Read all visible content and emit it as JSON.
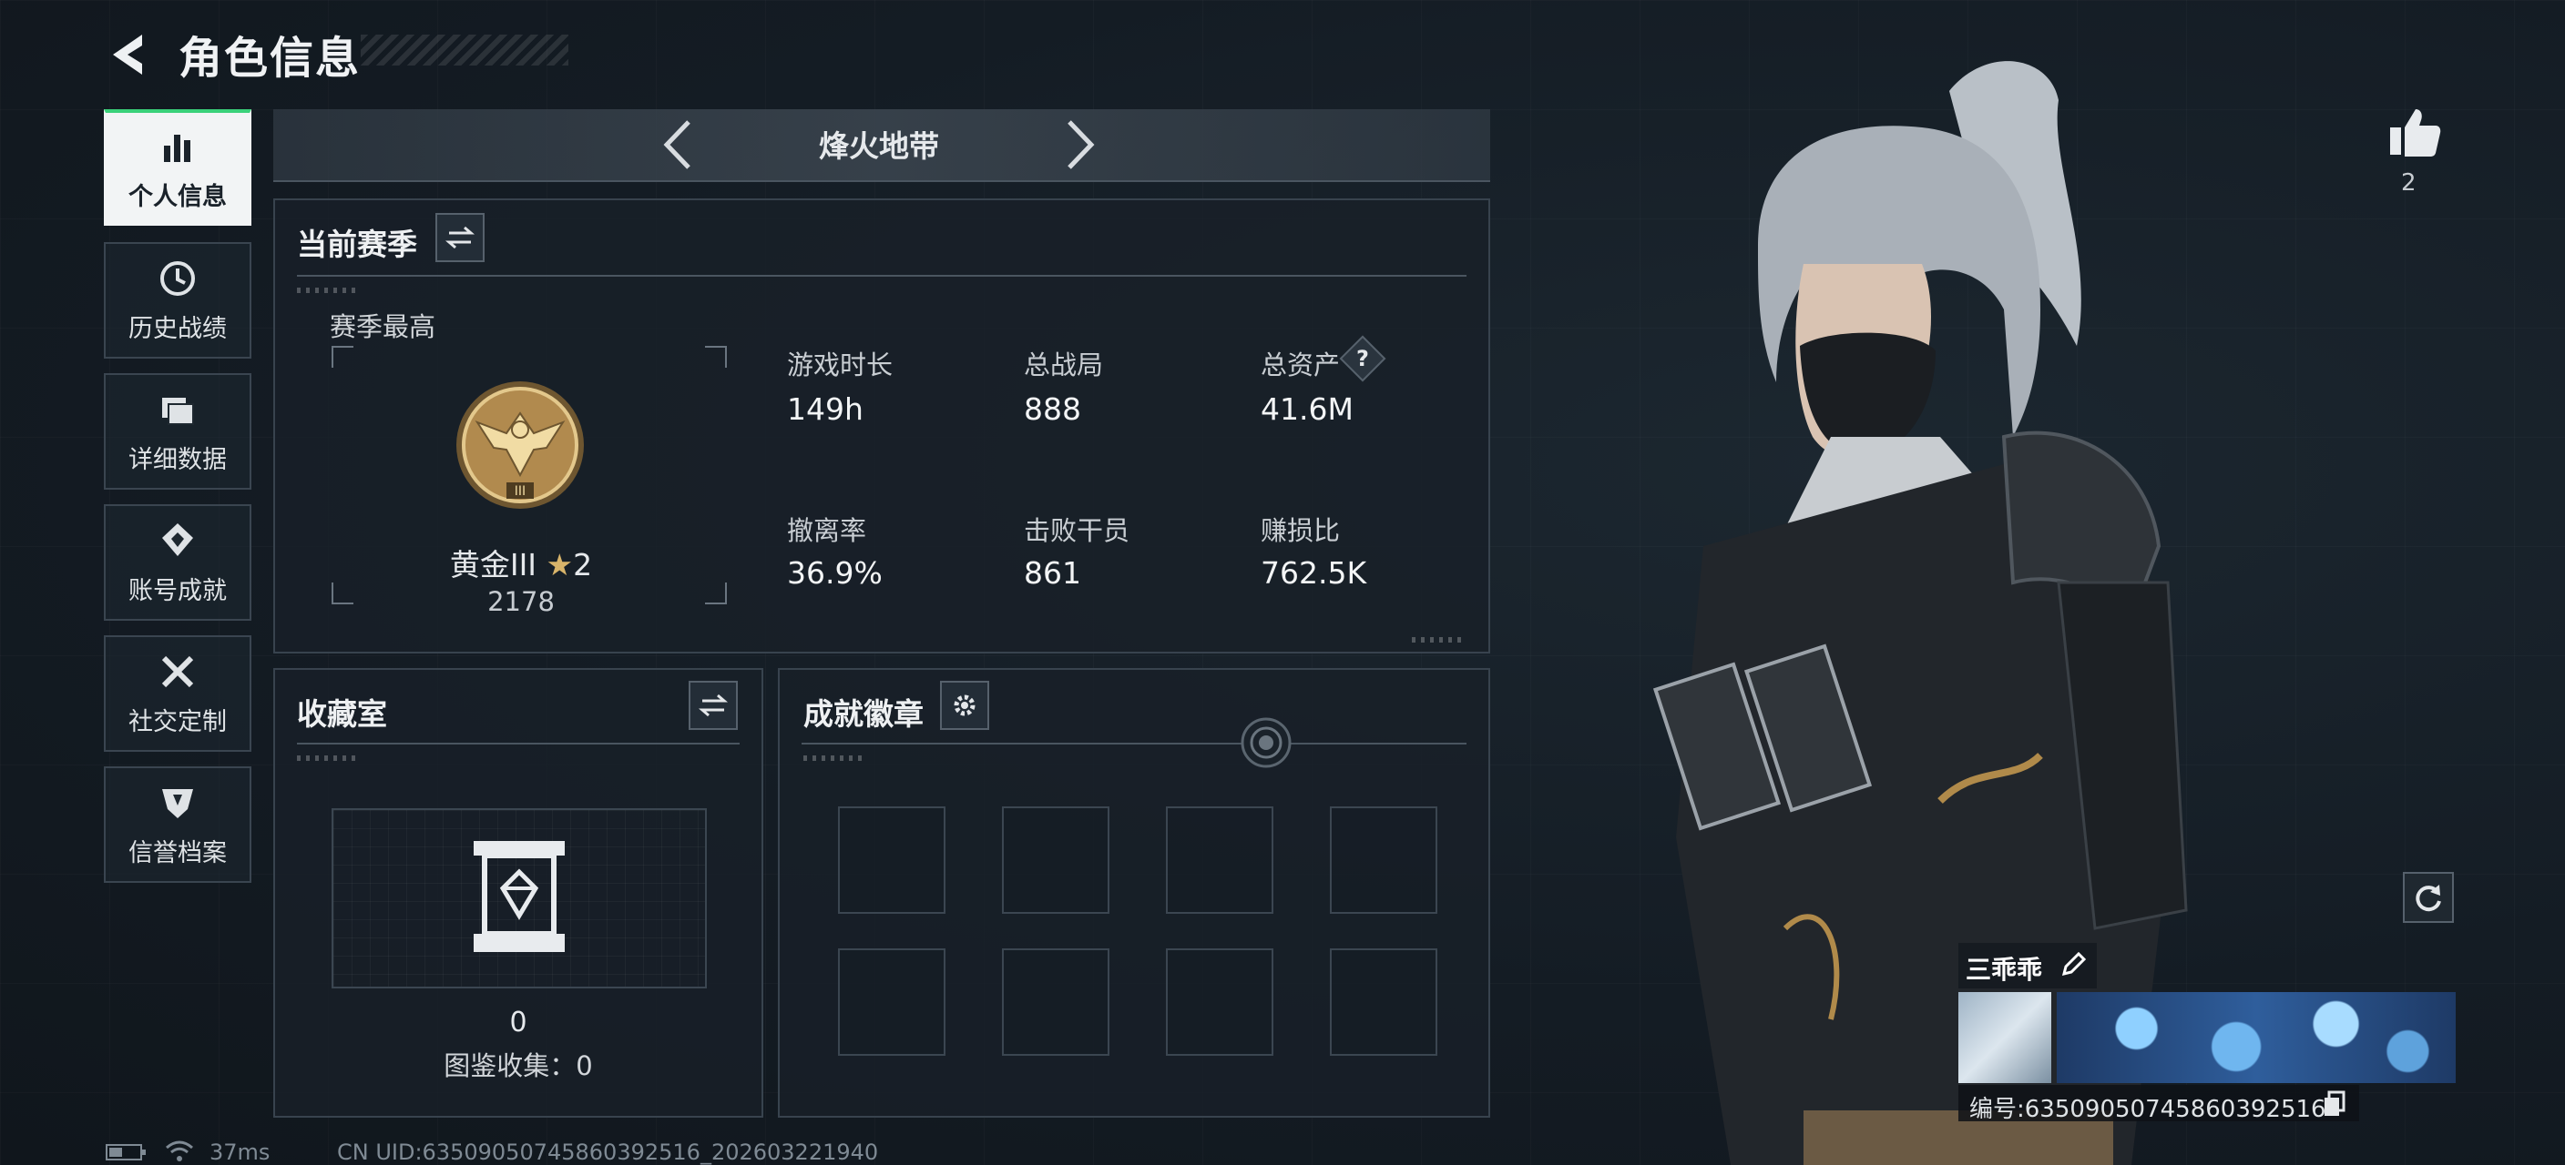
{
  "header": {
    "title": "角色信息"
  },
  "sidebar": {
    "items": [
      {
        "label": "个人信息",
        "icon": "bar-chart-icon",
        "active": true
      },
      {
        "label": "历史战绩",
        "icon": "history-icon"
      },
      {
        "label": "详细数据",
        "icon": "folder-icon"
      },
      {
        "label": "账号成就",
        "icon": "achievement-icon"
      },
      {
        "label": "社交定制",
        "icon": "tools-icon"
      },
      {
        "label": "信誉档案",
        "icon": "shield-icon"
      }
    ]
  },
  "mode_selector": {
    "label": "烽火地带"
  },
  "season": {
    "title": "当前赛季",
    "best_label": "赛季最高",
    "rank_name": "黄金III",
    "rank_stars": "2",
    "rank_points": "2178",
    "stats": [
      {
        "label": "游戏时长",
        "value": "149h"
      },
      {
        "label": "总战局",
        "value": "888"
      },
      {
        "label": "总资产",
        "value": "41.6M",
        "help": "?"
      },
      {
        "label": "撤离率",
        "value": "36.9%"
      },
      {
        "label": "击败干员",
        "value": "861"
      },
      {
        "label": "赚损比",
        "value": "762.5K"
      }
    ]
  },
  "collection": {
    "title": "收藏室",
    "count": "0",
    "codex_label": "图鉴收集：0"
  },
  "achievements": {
    "title": "成就徽章"
  },
  "profile": {
    "likes": "2",
    "name": "三乖乖",
    "uid_label": "编号:63509050745860392516"
  },
  "footer": {
    "ping": "37ms",
    "uid_text": "CN UID:63509050745860392516_202603221940"
  },
  "colors": {
    "accent_green": "#3ad17a",
    "panel_border": "#38434e",
    "rank_gold": "#c9a15a"
  }
}
